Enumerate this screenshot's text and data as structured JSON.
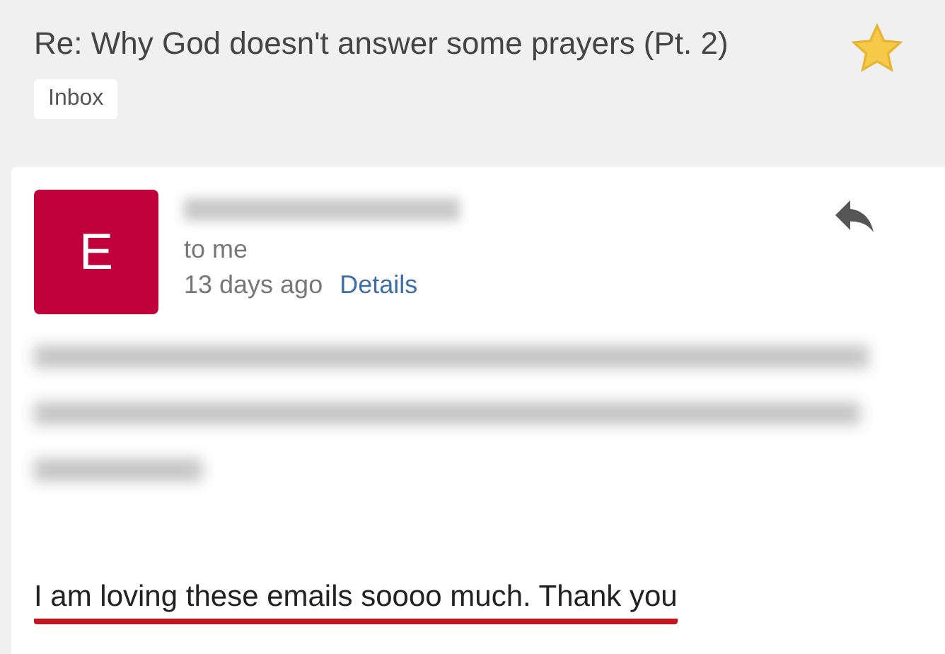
{
  "subject": "Re: Why God doesn't answer some prayers (Pt. 2)",
  "starred": true,
  "label": "Inbox",
  "message": {
    "avatar_letter": "E",
    "recipient": "to me",
    "time": "13 days ago",
    "details_link": "Details",
    "body": [
      {
        "kind": "blurred"
      },
      {
        "kind": "text",
        "text": "I am loving these emails soooo much. Thank you",
        "underlined": true
      }
    ]
  }
}
